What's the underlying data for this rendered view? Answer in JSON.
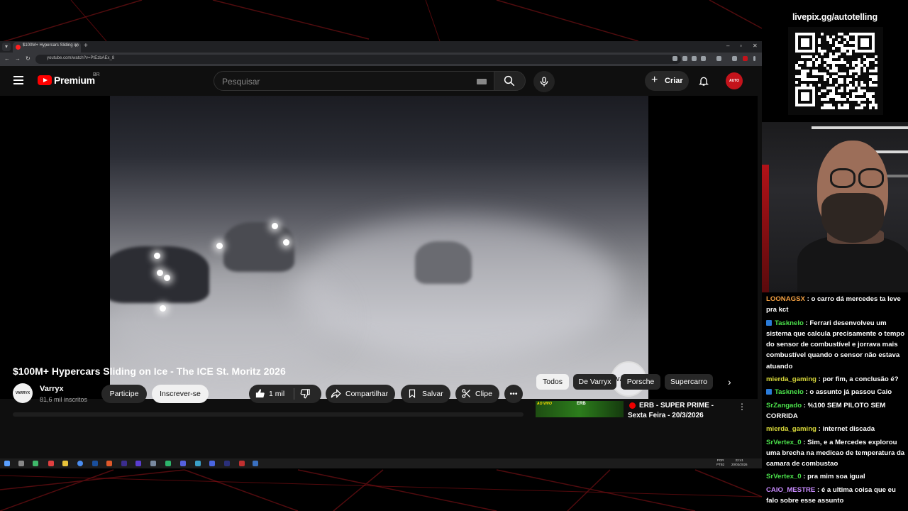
{
  "browser": {
    "tab_title": "$100M+ Hypercars Sliding on",
    "url": "youtube.com/watch?v=PtEzbAEx_8"
  },
  "youtube": {
    "brand": "Premium",
    "region": "BR",
    "search_placeholder": "Pesquisar",
    "create_label": "Criar",
    "account_avatar_text": "AUTO",
    "video_title": "$100M+ Hypercars Sliding on Ice - The ICE St. Moritz 2026",
    "watermark_text": "VARRYX",
    "channel": {
      "avatar_text": "VARRYX",
      "name": "Varryx",
      "subscribers": "81,6 mil inscritos",
      "join_label": "Participe",
      "subscribe_label": "Inscrever-se"
    },
    "actions": {
      "likes": "1 mil",
      "share": "Compartilhar",
      "save": "Salvar",
      "clip": "Clipe"
    },
    "chips": [
      "Todos",
      "De Varryx",
      "Porsche",
      "Supercarro"
    ],
    "recommendation": {
      "live_badge": "AO VIVO",
      "thumb_text": "ERB",
      "title": "ERB - SUPER PRIME - Sexta Feira - 20/3/2026"
    }
  },
  "taskbar": {
    "lang_top": "POR",
    "lang_bottom": "PTB2",
    "time": "22:41",
    "date": "20/03/2026"
  },
  "overlay": {
    "livepix_label": "livepix.gg/autotelling"
  },
  "chat": [
    {
      "user": "LOONAGSX",
      "color": "#f4a142",
      "badge": false,
      "text": "o carro dá mercedes ta leve pra kct"
    },
    {
      "user": "Tasknelo",
      "color": "#4be04b",
      "badge": true,
      "text": "Ferrari desenvolveu um sistema que calcula precisamente o tempo do sensor de combustível e jorrava mais combustível quando o sensor não estava atuando"
    },
    {
      "user": "mierda_gaming",
      "color": "#d9d93a",
      "badge": false,
      "text": "por fim, a conclusão é?"
    },
    {
      "user": "Tasknelo",
      "color": "#4be04b",
      "badge": true,
      "text": "o assunto já passou Caio"
    },
    {
      "user": "SrZangado",
      "color": "#4be04b",
      "badge": false,
      "text": "%100 SEM PILOTO SEM CORRIDA"
    },
    {
      "user": "mierda_gaming",
      "color": "#d9d93a",
      "badge": false,
      "text": "internet discada"
    },
    {
      "user": "SrVertex_0",
      "color": "#4be04b",
      "badge": false,
      "text": "Sim, e a Mercedes explorou uma brecha na medicao de temperatura da camara de combustao"
    },
    {
      "user": "SrVertex_0",
      "color": "#4be04b",
      "badge": false,
      "text": "pra mim soa igual"
    },
    {
      "user": "CAIO_MESTRE",
      "color": "#c98bff",
      "badge": false,
      "text": "é a ultima coisa que eu falo sobre esse assunto"
    }
  ],
  "colors": {
    "youtube_red": "#ff0000",
    "stream_red": "#c4131b"
  }
}
